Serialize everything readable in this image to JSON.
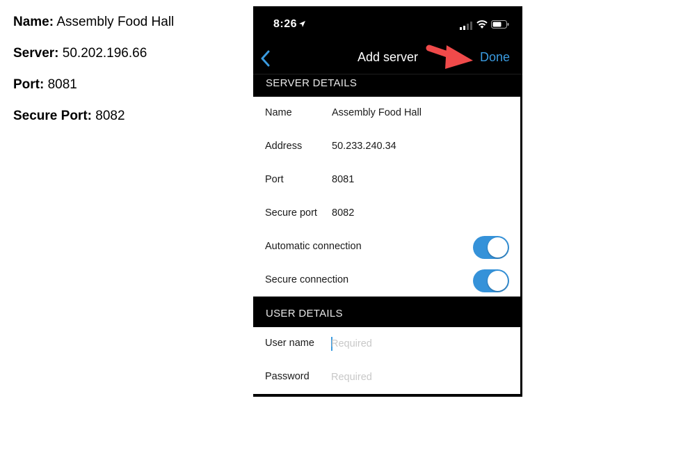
{
  "notes": [
    {
      "label": "Name:",
      "value": "Assembly Food Hall"
    },
    {
      "label": "Server:",
      "value": "50.202.196.66"
    },
    {
      "label": "Port:",
      "value": "8081"
    },
    {
      "label": "Secure Port:",
      "value": "8082"
    }
  ],
  "status_bar": {
    "time": "8:26",
    "icons": [
      "location-arrow-icon",
      "signal-icon",
      "wifi-icon",
      "battery-icon"
    ]
  },
  "nav": {
    "back_icon": "chevron-left-icon",
    "title": "Add server",
    "done_label": "Done",
    "annotation_icon": "red-arrow-icon"
  },
  "server_details": {
    "header": "SERVER DETAILS",
    "rows": [
      {
        "label": "Name",
        "value": "Assembly Food Hall"
      },
      {
        "label": "Address",
        "value": "50.233.240.34"
      },
      {
        "label": "Port",
        "value": "8081"
      },
      {
        "label": "Secure port",
        "value": "8082"
      }
    ],
    "toggles": [
      {
        "label": "Automatic connection",
        "on": true
      },
      {
        "label": "Secure connection",
        "on": true
      }
    ]
  },
  "user_details": {
    "header": "USER DETAILS",
    "username": {
      "label": "User name",
      "value": "",
      "placeholder": "Required"
    },
    "password": {
      "label": "Password",
      "value": "",
      "placeholder": "Required"
    }
  },
  "colors": {
    "accent": "#3a9be0",
    "toggle_on": "#3592d9",
    "annotation_red": "#f04a4a",
    "background_dark": "#000000"
  }
}
